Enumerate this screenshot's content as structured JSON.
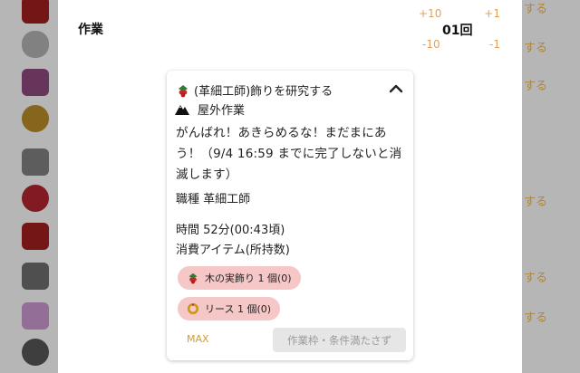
{
  "sheet": {
    "title": "作業",
    "counter": {
      "plus10": "+10",
      "plus1": "+1",
      "value": "01回",
      "minus10": "-10",
      "minus1": "-1"
    }
  },
  "background": {
    "right_texts": [
      "する",
      "する",
      "する",
      "する",
      "する",
      "する"
    ]
  },
  "card": {
    "title": "(革細工師)飾りを研究する",
    "work_type": "屋外作業",
    "description": "がんばれ！あきらめるな！まだまにあう！（9/4 16:59 までに完了しないと消滅します）",
    "job": "職種 革細工師",
    "time": "時間 52分(00:43頃)",
    "consume_label": "消費アイテム(所持数)",
    "items": [
      {
        "label": "木の実飾り 1 個(0)",
        "icon": "berry-ornament-icon"
      },
      {
        "label": "リース 1 個(0)",
        "icon": "wreath-icon"
      }
    ],
    "max_label": "MAX",
    "start_label": "作業枠・条件満たさず"
  },
  "colors": {
    "accent": "#d79b2f",
    "chip": "#f6c7c7",
    "disabled": "#e6e6e6"
  }
}
